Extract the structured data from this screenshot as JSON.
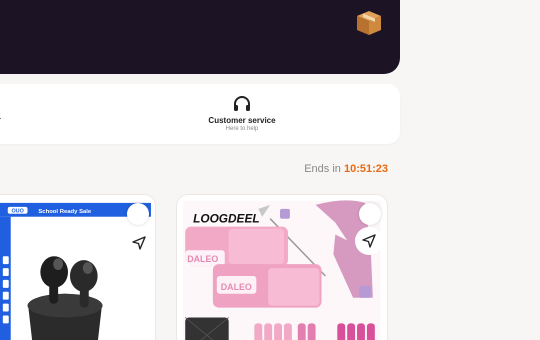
{
  "header": {
    "box_icon": "package-box-icon"
  },
  "service": {
    "label": "Customer service",
    "sublabel": "Here to help",
    "icon": "headphones-icon"
  },
  "countdown": {
    "prefix": "Ends in",
    "time": "10:51:23"
  },
  "products": [
    {
      "banner": "School Ready Sale",
      "brand_badge": "OUO",
      "icon_share": "share-send-icon"
    },
    {
      "brand": "LOOGDEEL",
      "strap_text": "DALEO",
      "icon_share": "share-send-icon"
    }
  ],
  "colors": {
    "hero_bg": "#1c1424",
    "accent_orange": "#e86a10",
    "page_bg": "#f8f6f4",
    "pink": "#f2a9c6",
    "blue": "#1f5fe0"
  }
}
